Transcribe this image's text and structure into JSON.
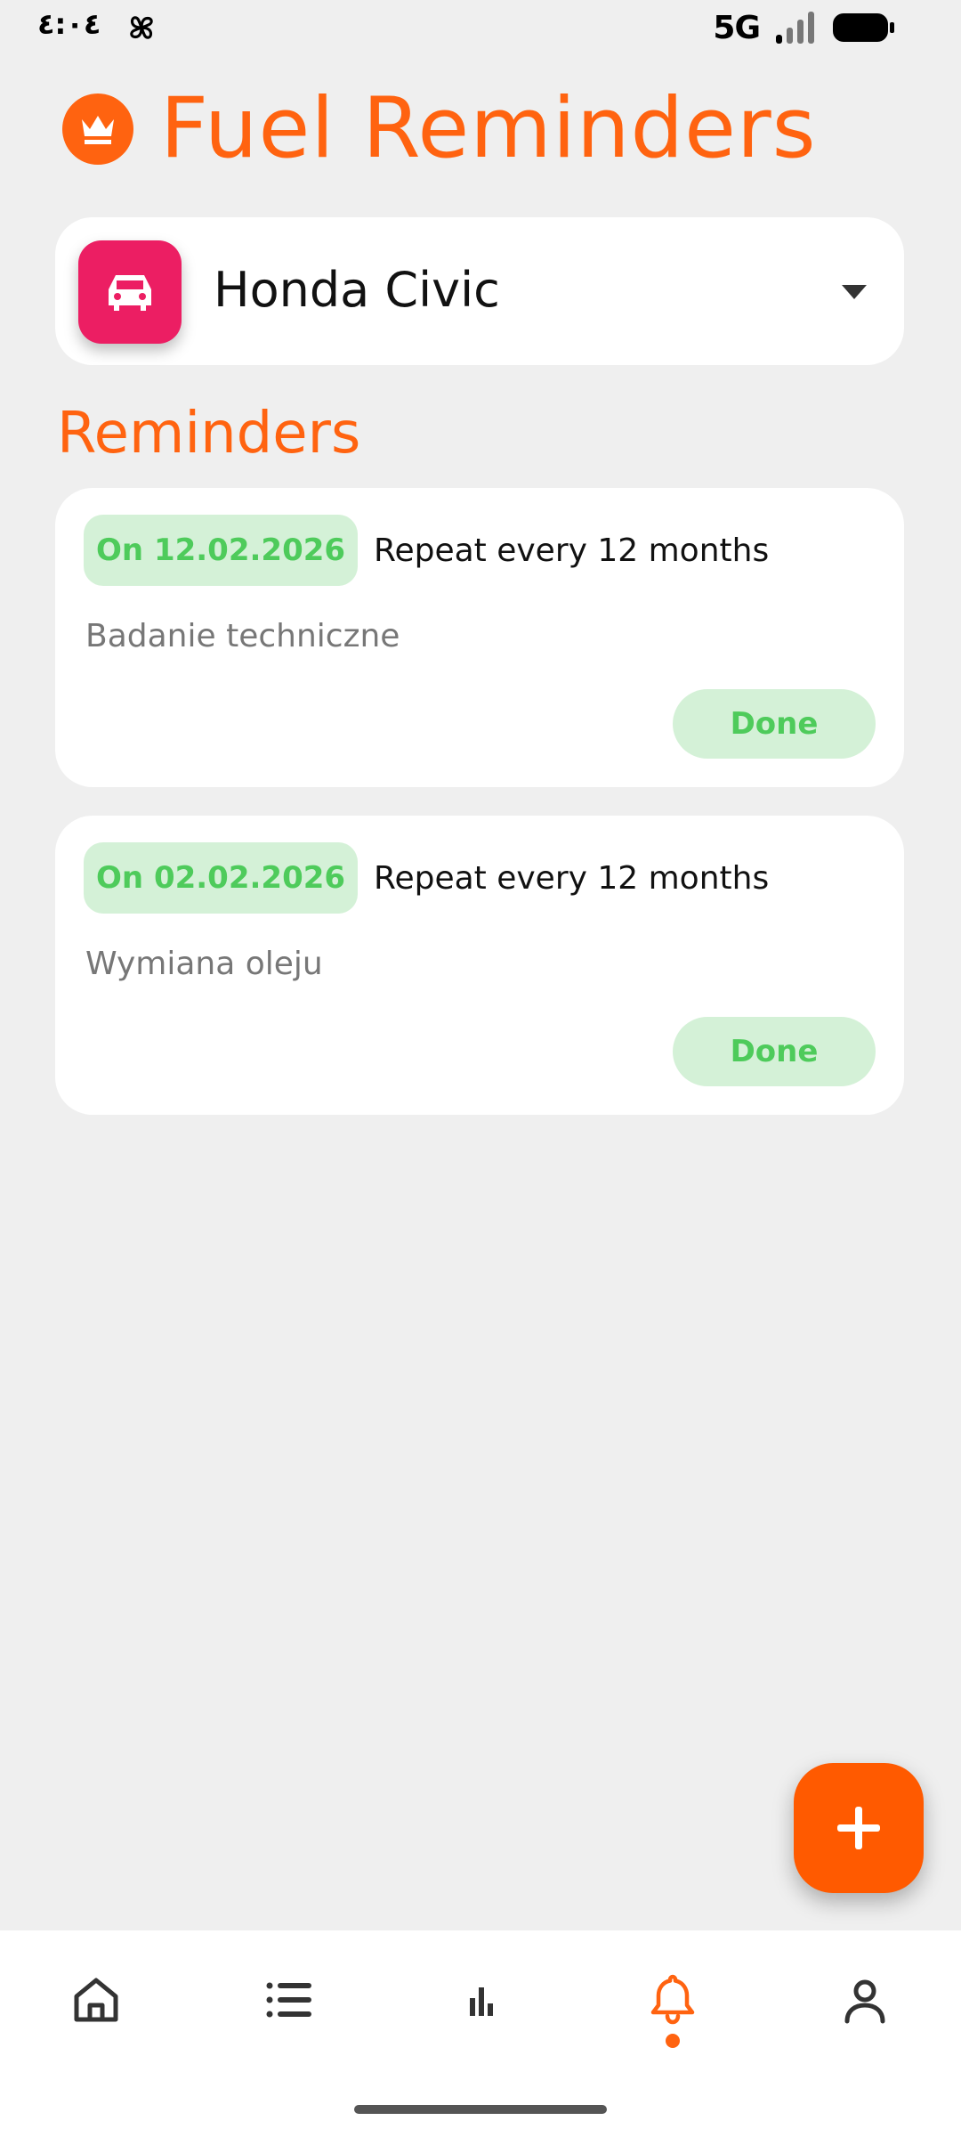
{
  "status_bar": {
    "time": "٤:٠٤",
    "network": "5G"
  },
  "header": {
    "title": "Fuel Reminders",
    "accent_color": "#ff6310"
  },
  "vehicle_selector": {
    "name": "Honda Civic",
    "icon": "car-icon",
    "icon_bg_color": "#ec1e63"
  },
  "reminders_section": {
    "title": "Reminders",
    "items": [
      {
        "date_label": "On 12.02.2026",
        "repeat_label": "Repeat every 12 months",
        "name": "Badanie techniczne",
        "done_label": "Done"
      },
      {
        "date_label": "On 02.02.2026",
        "repeat_label": "Repeat every 12 months",
        "name": "Wymiana oleju",
        "done_label": "Done"
      }
    ]
  },
  "fab": {
    "icon": "plus-icon",
    "color": "#ff5a00"
  },
  "bottom_nav": {
    "items": [
      {
        "icon": "home-icon"
      },
      {
        "icon": "list-icon"
      },
      {
        "icon": "bar-chart-icon"
      },
      {
        "icon": "bell-icon",
        "active": true
      },
      {
        "icon": "profile-icon"
      }
    ],
    "active_color": "#ff6310"
  }
}
